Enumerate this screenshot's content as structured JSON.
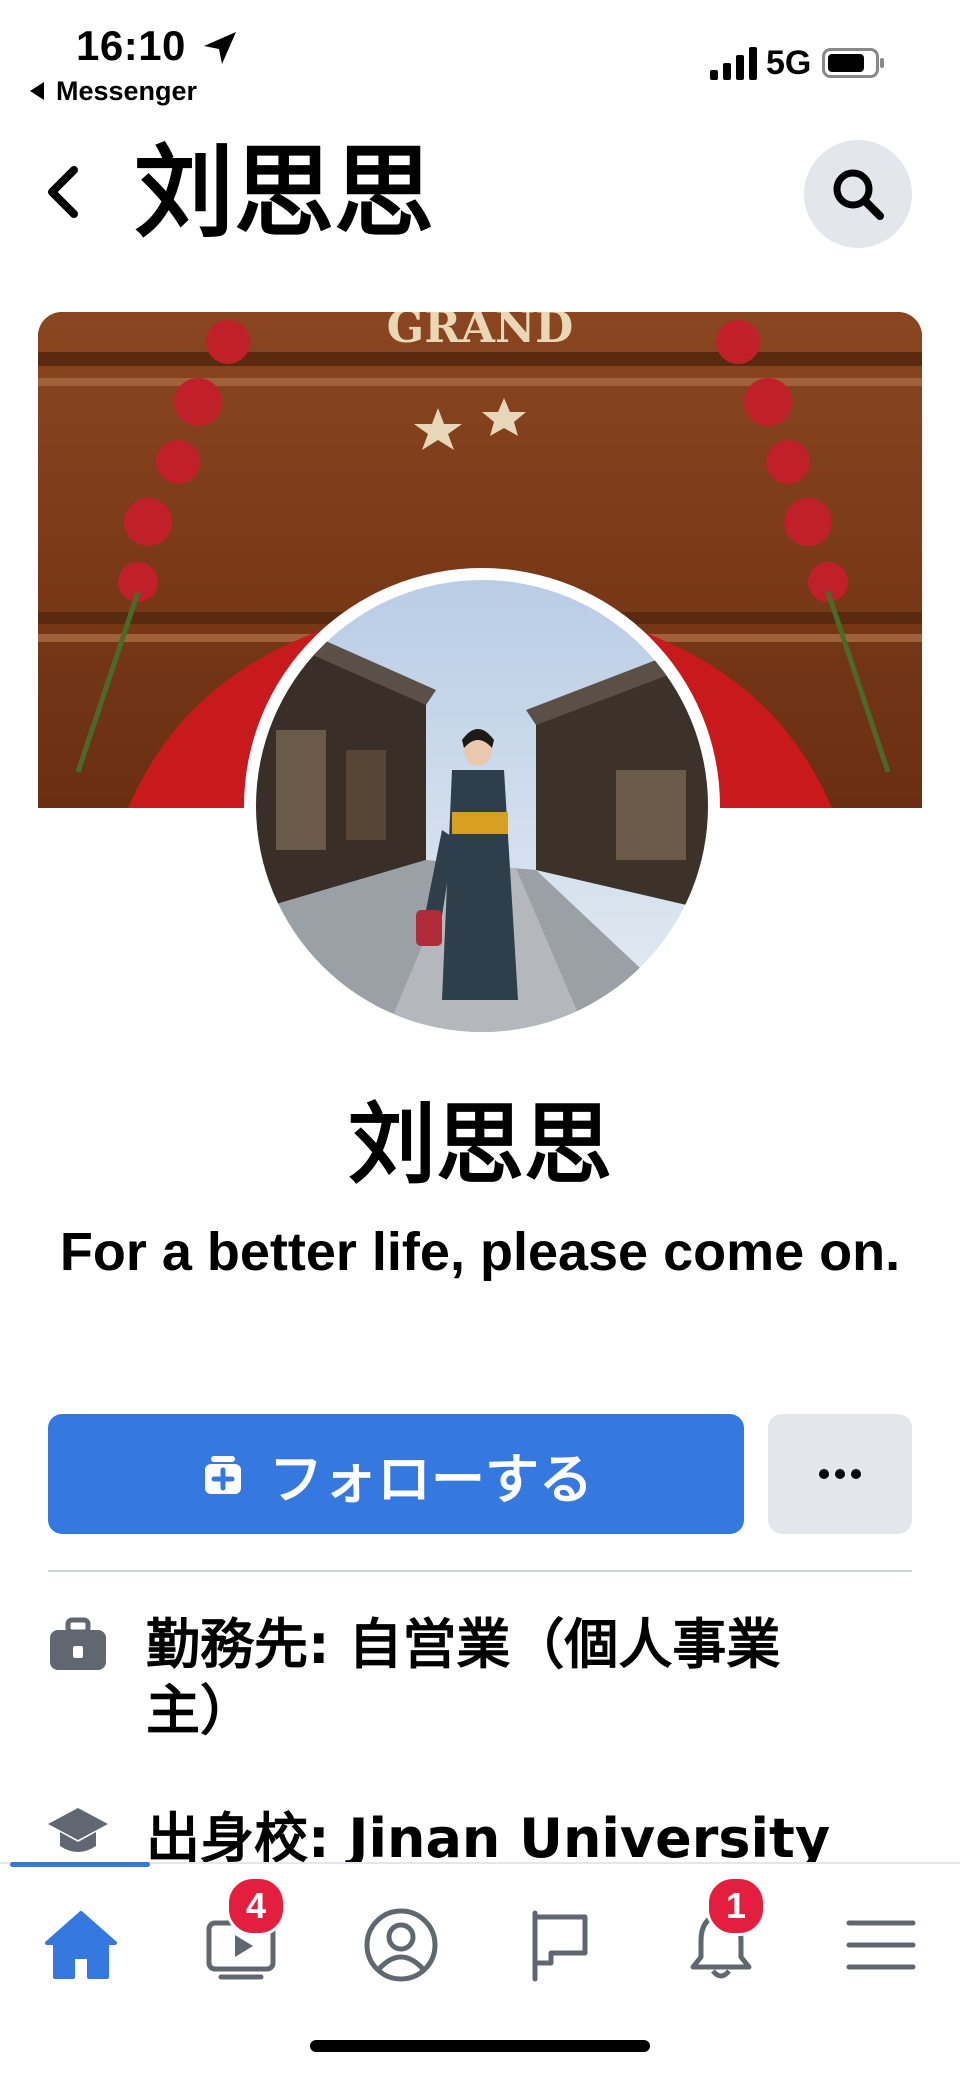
{
  "status_bar": {
    "time": "16:10",
    "back_app": "Messenger",
    "network": "5G"
  },
  "header": {
    "title": "刘思思"
  },
  "profile": {
    "name": "刘思思",
    "bio": "For a better life, please come on.",
    "cover_sign_text": "GRAND"
  },
  "actions": {
    "follow_label": "フォローする",
    "more_label": "···"
  },
  "details": [
    {
      "icon": "briefcase-icon",
      "text": "勤務先: 自営業（個人事業主）"
    },
    {
      "icon": "graduation-cap-icon",
      "text": "出身校: Jinan University"
    }
  ],
  "nav": {
    "items": [
      {
        "icon": "home-icon",
        "badge": ""
      },
      {
        "icon": "watch-icon",
        "badge": "4"
      },
      {
        "icon": "profile-icon",
        "badge": ""
      },
      {
        "icon": "pages-flag-icon",
        "badge": ""
      },
      {
        "icon": "notifications-bell-icon",
        "badge": "1"
      },
      {
        "icon": "menu-icon",
        "badge": ""
      }
    ]
  },
  "colors": {
    "accent": "#3578e0",
    "badge": "#e41e3f",
    "button_gray": "#e4e6eb"
  }
}
